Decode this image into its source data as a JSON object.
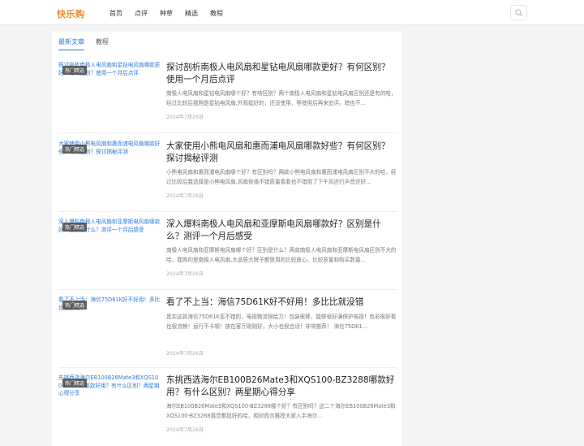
{
  "header": {
    "logo": "快乐购",
    "nav": [
      "首页",
      "点评",
      "种草",
      "精选",
      "教程"
    ],
    "search_icon": "search-icon"
  },
  "tabs": [
    "最新文章",
    "教程"
  ],
  "articles": [
    {
      "thumb_alt": "探讨剖析南极人电风扇和星钻电风扇哪款更好？有何区别？使用一个月后点评",
      "tag": "热门精选",
      "title": "探讨剖析南极人电风扇和星钻电风扇哪款更好？有何区别？使用一个月后点评",
      "excerpt": "南极人电风扇和星钻电风扇哪个好？有啥区别？两个南极人电风扇和星钻电风扇区别还是有的哈，经过比较后我购是星钻电风扇,外观挺好的，还没使用，等使用后再来追评。暗也不…",
      "date": "2024年7月26日"
    },
    {
      "thumb_alt": "大家使用小熊电风扇和惠而浦电风扇哪款好些？有何区别？探讨揭秘评测",
      "tag": "热门精选",
      "title": "大家使用小熊电风扇和惠而浦电风扇哪款好些？有何区别？探讨揭秘评测",
      "excerpt": "小熊电风扇和惠而浦电风扇哪个好？有区别吗？两款小熊电风扇和惠而浦电风扇区别不大的哈，经过比较后我选择是小熊电风扇,风扇很值不错质量看着也不错用了下午风还行声音还好…",
      "date": "2024年7月26日"
    },
    {
      "thumb_alt": "深入爆料南极人电风扇和亚摩斯电风扇哪款好？区别是什么？测评一个月后感受",
      "tag": "热门精选",
      "title": "深入爆料南极人电风扇和亚摩斯电风扇哪款好？区别是什么？测评一个月后感受",
      "excerpt": "南极人电风扇和亚摩斯电风扇哪个好？区别是什么？两款南极人电风扇和亚摩斯电风扇区别不大的哈，我购的是南极人电风扇,大品质大牌子都是用的比较放心，比较质量和购买数量…",
      "date": "2024年7月26日"
    },
    {
      "thumb_alt": "看了不上当：海信75D61K好不好用！多比比就没错",
      "tag": "热门精选",
      "title": "看了不上当：海信75D61K好不好用！多比比就没错",
      "excerpt": "其实这款海信75D61K蛮不错的，电视物流很给力！包装很棒，能够很好满保护电视！色彩很好看也很流畅！运行不卡顿！放在客厅刚刚好，大小也很合适！非常推荐！ 海信75D61…",
      "date": "2024年7月26日"
    },
    {
      "thumb_alt": "东挑西选海尔EB100B26Mate3和XQS100-BZ3288哪款好用？有什么区别？两星期心得分享",
      "tag": "热门精选",
      "title": "东挑西选海尔EB100B26Mate3和XQS100-BZ3288哪款好用？有什么区别？两星期心得分享",
      "excerpt": "海尔EB100B26Mate3和XQS100-BZ3288哪个好？有区别吗？这二个海尔EB100B26Mate3和XQS100-BZ3288感觉都挺好的哈，相对而言推荐大家入手海尔…",
      "date": "2024年7月26日"
    }
  ]
}
